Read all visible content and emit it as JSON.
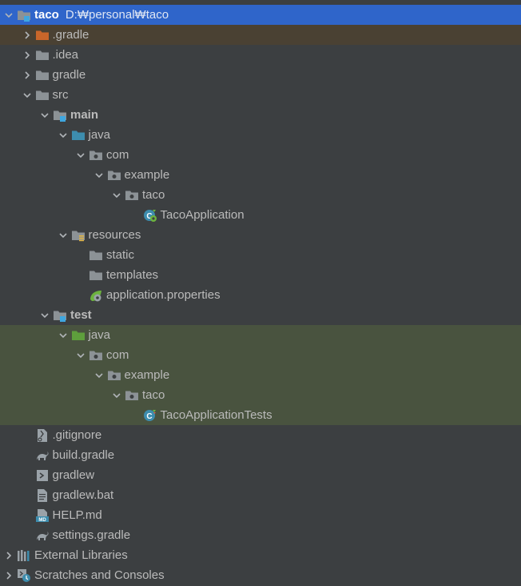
{
  "project": {
    "name": "taco",
    "path": "D:₩personal₩taco"
  },
  "tree": [
    {
      "label": "taco",
      "depth": 0,
      "chevron": "down",
      "icon": "project-folder-icon",
      "bold": true,
      "state": "selected",
      "path": "D:₩personal₩taco"
    },
    {
      "label": ".gradle",
      "depth": 1,
      "chevron": "right",
      "icon": "excluded-folder-icon",
      "state": "excluded"
    },
    {
      "label": ".idea",
      "depth": 1,
      "chevron": "right",
      "icon": "folder-icon"
    },
    {
      "label": "gradle",
      "depth": 1,
      "chevron": "right",
      "icon": "folder-icon"
    },
    {
      "label": "src",
      "depth": 1,
      "chevron": "down",
      "icon": "folder-icon"
    },
    {
      "label": "main",
      "depth": 2,
      "chevron": "down",
      "icon": "module-folder-icon",
      "bold": true
    },
    {
      "label": "java",
      "depth": 3,
      "chevron": "down",
      "icon": "source-root-folder-icon"
    },
    {
      "label": "com",
      "depth": 4,
      "chevron": "down",
      "icon": "package-icon"
    },
    {
      "label": "example",
      "depth": 5,
      "chevron": "down",
      "icon": "package-icon"
    },
    {
      "label": "taco",
      "depth": 6,
      "chevron": "down",
      "icon": "package-icon"
    },
    {
      "label": "TacoApplication",
      "depth": 7,
      "chevron": "none",
      "icon": "spring-boot-class-icon"
    },
    {
      "label": "resources",
      "depth": 3,
      "chevron": "down",
      "icon": "resources-folder-icon"
    },
    {
      "label": "static",
      "depth": 4,
      "chevron": "none",
      "icon": "folder-icon"
    },
    {
      "label": "templates",
      "depth": 4,
      "chevron": "none",
      "icon": "folder-icon"
    },
    {
      "label": "application.properties",
      "depth": 4,
      "chevron": "none",
      "icon": "spring-properties-icon"
    },
    {
      "label": "test",
      "depth": 2,
      "chevron": "down",
      "icon": "module-folder-icon",
      "bold": true
    },
    {
      "label": "java",
      "depth": 3,
      "chevron": "down",
      "icon": "test-source-folder-icon",
      "state": "testsrc"
    },
    {
      "label": "com",
      "depth": 4,
      "chevron": "down",
      "icon": "package-icon",
      "state": "testsrc"
    },
    {
      "label": "example",
      "depth": 5,
      "chevron": "down",
      "icon": "package-icon",
      "state": "testsrc"
    },
    {
      "label": "taco",
      "depth": 6,
      "chevron": "down",
      "icon": "package-icon",
      "state": "testsrc"
    },
    {
      "label": "TacoApplicationTests",
      "depth": 7,
      "chevron": "none",
      "icon": "test-class-icon",
      "state": "testsrc"
    },
    {
      "label": ".gitignore",
      "depth": 1,
      "chevron": "none",
      "icon": "gitignore-file-icon"
    },
    {
      "label": "build.gradle",
      "depth": 1,
      "chevron": "none",
      "icon": "gradle-file-icon"
    },
    {
      "label": "gradlew",
      "depth": 1,
      "chevron": "none",
      "icon": "shell-script-icon"
    },
    {
      "label": "gradlew.bat",
      "depth": 1,
      "chevron": "none",
      "icon": "text-file-icon"
    },
    {
      "label": "HELP.md",
      "depth": 1,
      "chevron": "none",
      "icon": "markdown-file-icon"
    },
    {
      "label": "settings.gradle",
      "depth": 1,
      "chevron": "none",
      "icon": "gradle-file-icon"
    },
    {
      "label": "External Libraries",
      "depth": 0,
      "chevron": "right",
      "icon": "external-libraries-icon"
    },
    {
      "label": "Scratches and Consoles",
      "depth": 0,
      "chevron": "right",
      "icon": "scratches-icon"
    }
  ],
  "colors": {
    "background": "#3c3f41",
    "selected": "#2f65ca",
    "excluded": "#4a4133",
    "test_source": "#49533f",
    "folder": "#8c9296",
    "source_root": "#3d8dae",
    "test_root": "#5e9f3c",
    "excluded_folder": "#c9662a"
  }
}
